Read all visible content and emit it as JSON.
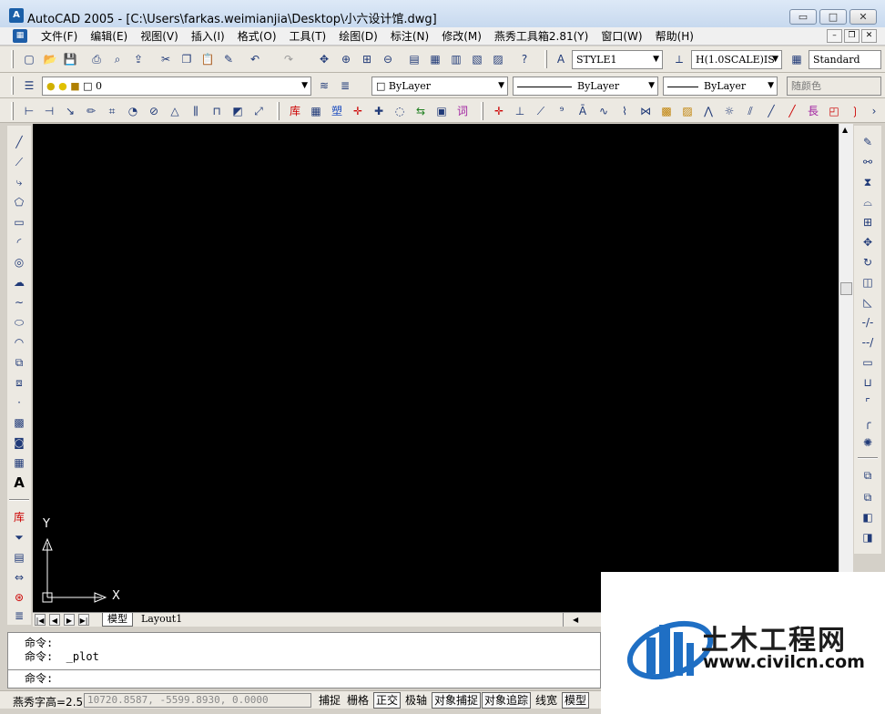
{
  "window": {
    "title": "AutoCAD 2005 - [C:\\Users\\farkas.weimianjia\\Desktop\\小六设计馆.dwg]",
    "app_icon_glyph": "A",
    "minimize_glyph": "▭",
    "maximize_glyph": "□",
    "close_glyph": "✕"
  },
  "menubar": {
    "doc_icon_glyph": "▦",
    "items": [
      "文件(F)",
      "编辑(E)",
      "视图(V)",
      "插入(I)",
      "格式(O)",
      "工具(T)",
      "绘图(D)",
      "标注(N)",
      "修改(M)",
      "燕秀工具箱2.81(Y)",
      "窗口(W)",
      "帮助(H)"
    ],
    "mdi_minimize": "–",
    "mdi_restore": "❐",
    "mdi_close": "✕"
  },
  "standard_toolbar": {
    "text_style": "STYLE1",
    "dim_style": "H(1.0SCALE)IS",
    "table_style": "Standard"
  },
  "layers_toolbar": {
    "current_layer": "0",
    "color": "ByLayer",
    "linetype": "ByLayer",
    "lineweight": "ByLayer",
    "plot_style": "随颜色"
  },
  "left_toolbar_icons": [
    "line-icon",
    "construction-line-icon",
    "polyline-icon",
    "polygon-icon",
    "rectangle-icon",
    "arc-icon",
    "circle-icon",
    "revision-cloud-icon",
    "spline-icon",
    "ellipse-icon",
    "ellipse-arc-icon",
    "insert-block-icon",
    "make-block-icon",
    "point-icon",
    "hatch-icon",
    "region-icon",
    "table-icon",
    "multiline-text-icon"
  ],
  "left_toolbar_extra": {
    "library_glyph": "库",
    "text_glyph": "A"
  },
  "ucs": {
    "x_label": "X",
    "y_label": "Y"
  },
  "layout_tabs": {
    "model": "模型",
    "layout1": "Layout1"
  },
  "command_window": {
    "lines": [
      "命令:",
      "命令:  _plot"
    ],
    "prompt": "命令:"
  },
  "statusbar": {
    "label": "燕秀字高=2.5",
    "coords": "10720.8587, -5599.8930, 0.0000",
    "buttons": [
      {
        "label": "捕捉",
        "on": false
      },
      {
        "label": "栅格",
        "on": false
      },
      {
        "label": "正交",
        "on": true
      },
      {
        "label": "极轴",
        "on": false
      },
      {
        "label": "对象捕捉",
        "on": true
      },
      {
        "label": "对象追踪",
        "on": true
      },
      {
        "label": "线宽",
        "on": false
      },
      {
        "label": "模型",
        "on": true
      }
    ]
  },
  "watermark": {
    "title": "土木工程网",
    "url": "www.civilcn.com"
  },
  "colors": {
    "canvas": "#000000",
    "ui_face": "#ece9e2",
    "watermark_blue": "#1f6fc4"
  }
}
